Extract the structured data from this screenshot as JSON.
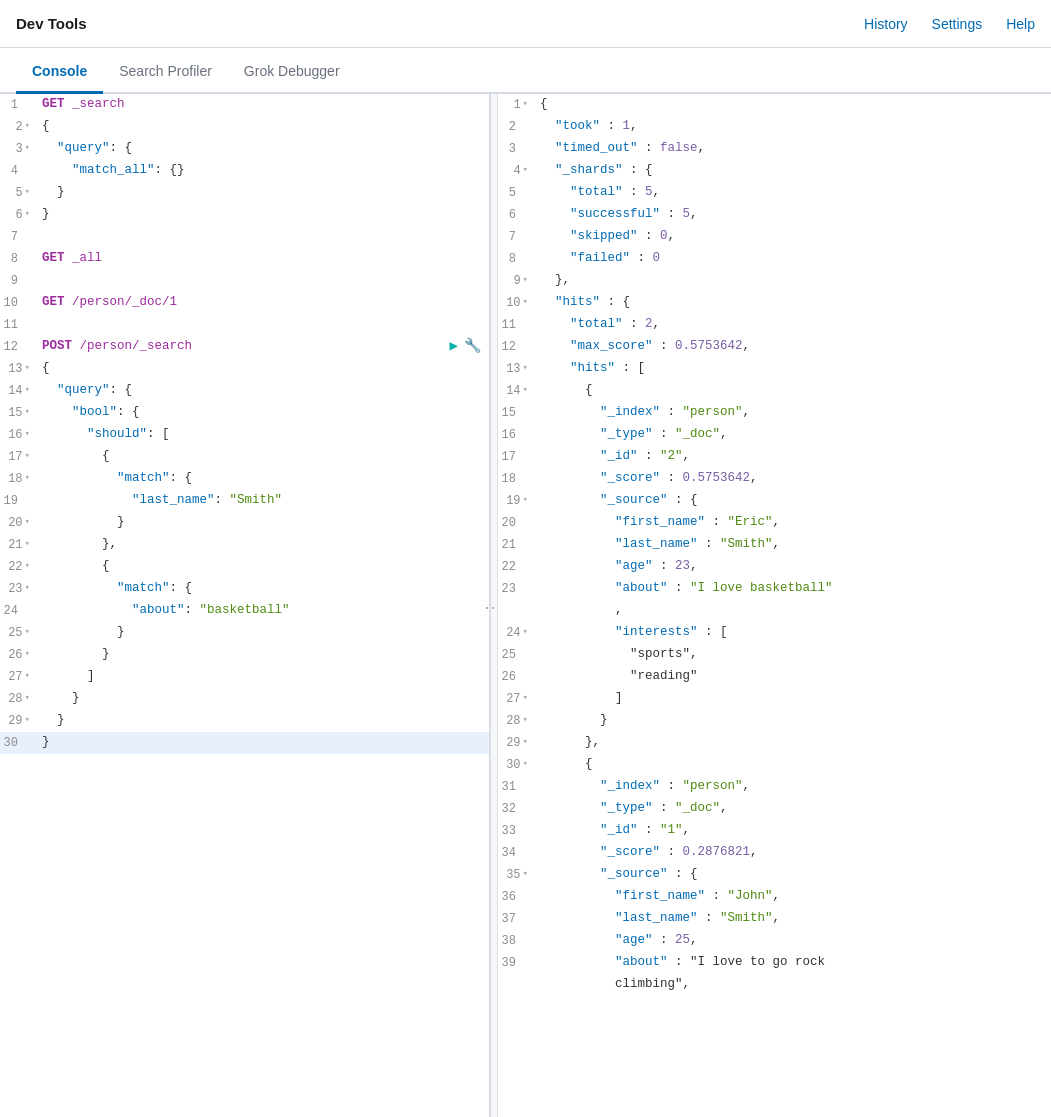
{
  "topBar": {
    "title": "Dev Tools",
    "nav": [
      "History",
      "Settings",
      "Help"
    ]
  },
  "tabs": [
    {
      "id": "console",
      "label": "Console",
      "active": true
    },
    {
      "id": "search-profiler",
      "label": "Search Profiler",
      "active": false
    },
    {
      "id": "grok-debugger",
      "label": "Grok Debugger",
      "active": false
    }
  ],
  "editor": {
    "lines": [
      {
        "num": 1,
        "fold": false,
        "content": "GET _search",
        "type": "method-line"
      },
      {
        "num": 2,
        "fold": true,
        "content": "{",
        "type": "bracket"
      },
      {
        "num": 3,
        "fold": true,
        "content": "  \"query\": {",
        "type": "key"
      },
      {
        "num": 4,
        "fold": false,
        "content": "    \"match_all\": {}",
        "type": "key"
      },
      {
        "num": 5,
        "fold": true,
        "content": "  }",
        "type": "bracket"
      },
      {
        "num": 6,
        "fold": true,
        "content": "}",
        "type": "bracket"
      },
      {
        "num": 7,
        "fold": false,
        "content": "",
        "type": "empty"
      },
      {
        "num": 8,
        "fold": false,
        "content": "GET _all",
        "type": "method-line"
      },
      {
        "num": 9,
        "fold": false,
        "content": "",
        "type": "empty"
      },
      {
        "num": 10,
        "fold": false,
        "content": "GET /person/_doc/1",
        "type": "method-line"
      },
      {
        "num": 11,
        "fold": false,
        "content": "",
        "type": "empty"
      },
      {
        "num": 12,
        "fold": false,
        "content": "POST /person/_search",
        "type": "method-line",
        "hasActions": true
      },
      {
        "num": 13,
        "fold": true,
        "content": "{",
        "type": "bracket"
      },
      {
        "num": 14,
        "fold": true,
        "content": "  \"query\": {",
        "type": "key"
      },
      {
        "num": 15,
        "fold": true,
        "content": "    \"bool\": {",
        "type": "key"
      },
      {
        "num": 16,
        "fold": true,
        "content": "      \"should\": [",
        "type": "key"
      },
      {
        "num": 17,
        "fold": true,
        "content": "        {",
        "type": "bracket"
      },
      {
        "num": 18,
        "fold": true,
        "content": "          \"match\": {",
        "type": "key"
      },
      {
        "num": 19,
        "fold": false,
        "content": "            \"last_name\": \"Smith\"",
        "type": "key-value-str"
      },
      {
        "num": 20,
        "fold": true,
        "content": "          }",
        "type": "bracket"
      },
      {
        "num": 21,
        "fold": true,
        "content": "        },",
        "type": "bracket"
      },
      {
        "num": 22,
        "fold": true,
        "content": "        {",
        "type": "bracket"
      },
      {
        "num": 23,
        "fold": true,
        "content": "          \"match\": {",
        "type": "key"
      },
      {
        "num": 24,
        "fold": false,
        "content": "            \"about\": \"basketball\"",
        "type": "key-value-str"
      },
      {
        "num": 25,
        "fold": true,
        "content": "          }",
        "type": "bracket"
      },
      {
        "num": 26,
        "fold": true,
        "content": "        }",
        "type": "bracket"
      },
      {
        "num": 27,
        "fold": true,
        "content": "      ]",
        "type": "bracket"
      },
      {
        "num": 28,
        "fold": true,
        "content": "    }",
        "type": "bracket"
      },
      {
        "num": 29,
        "fold": true,
        "content": "  }",
        "type": "bracket"
      },
      {
        "num": 30,
        "fold": false,
        "content": "}",
        "type": "bracket",
        "highlighted": true
      }
    ]
  },
  "output": {
    "lines": [
      {
        "num": 1,
        "fold": true,
        "content": "{"
      },
      {
        "num": 2,
        "fold": false,
        "content": "  \"took\" : 1,"
      },
      {
        "num": 3,
        "fold": false,
        "content": "  \"timed_out\" : false,"
      },
      {
        "num": 4,
        "fold": true,
        "content": "  \"_shards\" : {"
      },
      {
        "num": 5,
        "fold": false,
        "content": "    \"total\" : 5,"
      },
      {
        "num": 6,
        "fold": false,
        "content": "    \"successful\" : 5,"
      },
      {
        "num": 7,
        "fold": false,
        "content": "    \"skipped\" : 0,"
      },
      {
        "num": 8,
        "fold": false,
        "content": "    \"failed\" : 0"
      },
      {
        "num": 9,
        "fold": true,
        "content": "  },"
      },
      {
        "num": 10,
        "fold": true,
        "content": "  \"hits\" : {"
      },
      {
        "num": 11,
        "fold": false,
        "content": "    \"total\" : 2,"
      },
      {
        "num": 12,
        "fold": false,
        "content": "    \"max_score\" : 0.5753642,"
      },
      {
        "num": 13,
        "fold": true,
        "content": "    \"hits\" : ["
      },
      {
        "num": 14,
        "fold": true,
        "content": "      {"
      },
      {
        "num": 15,
        "fold": false,
        "content": "        \"_index\" : \"person\","
      },
      {
        "num": 16,
        "fold": false,
        "content": "        \"_type\" : \"_doc\","
      },
      {
        "num": 17,
        "fold": false,
        "content": "        \"_id\" : \"2\","
      },
      {
        "num": 18,
        "fold": false,
        "content": "        \"_score\" : 0.5753642,"
      },
      {
        "num": 19,
        "fold": true,
        "content": "        \"_source\" : {"
      },
      {
        "num": 20,
        "fold": false,
        "content": "          \"first_name\" : \"Eric\","
      },
      {
        "num": 21,
        "fold": false,
        "content": "          \"last_name\" : \"Smith\","
      },
      {
        "num": 22,
        "fold": false,
        "content": "          \"age\" : 23,"
      },
      {
        "num": 23,
        "fold": false,
        "content": "          \"about\" : \"I love basketball\""
      },
      {
        "num": "",
        "fold": false,
        "content": "          ,"
      },
      {
        "num": 24,
        "fold": true,
        "content": "          \"interests\" : ["
      },
      {
        "num": 25,
        "fold": false,
        "content": "            \"sports\","
      },
      {
        "num": 26,
        "fold": false,
        "content": "            \"reading\""
      },
      {
        "num": 27,
        "fold": true,
        "content": "          ]"
      },
      {
        "num": 28,
        "fold": true,
        "content": "        }"
      },
      {
        "num": 29,
        "fold": true,
        "content": "      },"
      },
      {
        "num": 30,
        "fold": true,
        "content": "      {"
      },
      {
        "num": 31,
        "fold": false,
        "content": "        \"_index\" : \"person\","
      },
      {
        "num": 32,
        "fold": false,
        "content": "        \"_type\" : \"_doc\","
      },
      {
        "num": 33,
        "fold": false,
        "content": "        \"_id\" : \"1\","
      },
      {
        "num": 34,
        "fold": false,
        "content": "        \"_score\" : 0.2876821,"
      },
      {
        "num": 35,
        "fold": true,
        "content": "        \"_source\" : {"
      },
      {
        "num": 36,
        "fold": false,
        "content": "          \"first_name\" : \"John\","
      },
      {
        "num": 37,
        "fold": false,
        "content": "          \"last_name\" : \"Smith\","
      },
      {
        "num": 38,
        "fold": false,
        "content": "          \"age\" : 25,"
      },
      {
        "num": 39,
        "fold": false,
        "content": "          \"about\" : \"I love to go rock"
      },
      {
        "num": "",
        "fold": false,
        "content": "          climbing\","
      }
    ]
  },
  "colors": {
    "accent": "#006bb4",
    "method_get": "#9d2b9d",
    "method_post": "#9d2b9d",
    "key": "#006bb4",
    "string": "#4f8a10",
    "number": "#795da3",
    "active_tab_border": "#006bb4"
  }
}
